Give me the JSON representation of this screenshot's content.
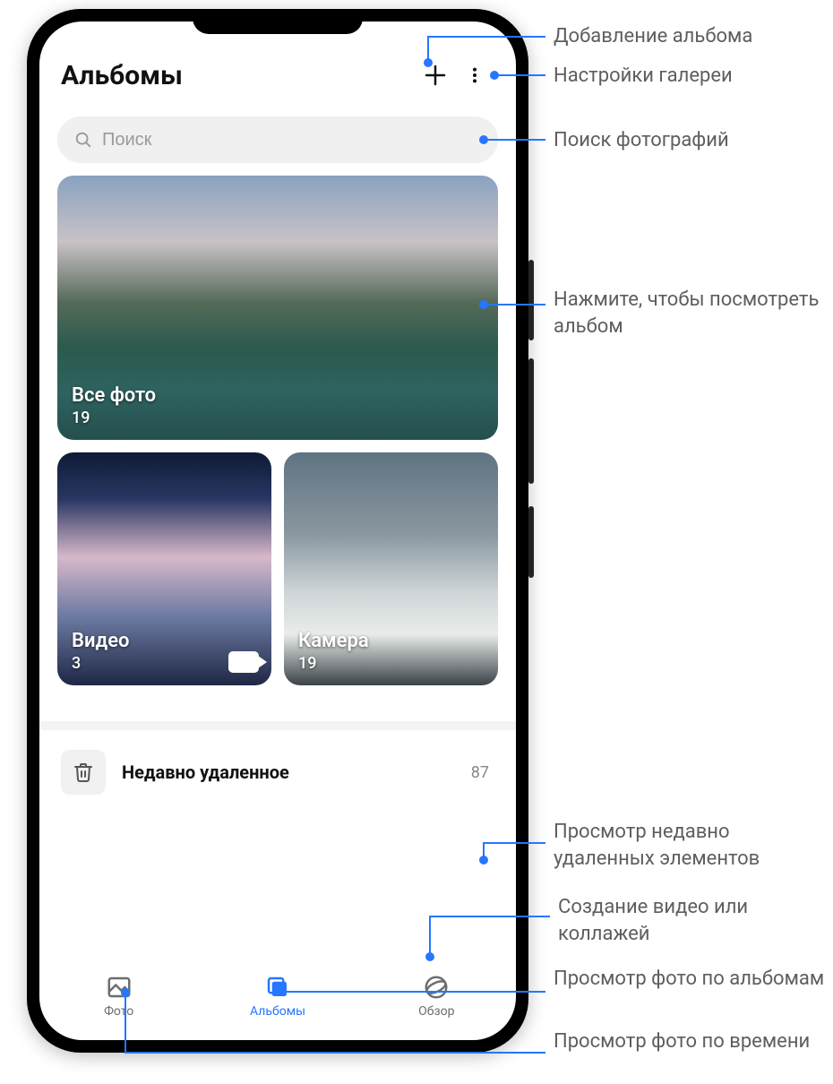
{
  "header": {
    "title": "Альбомы",
    "add_icon": "plus-icon",
    "menu_icon": "more-vertical-icon"
  },
  "search": {
    "placeholder": "Поиск",
    "icon": "search-icon"
  },
  "albums": [
    {
      "name": "Все фото",
      "count": "19",
      "kind": "big"
    },
    {
      "name": "Видео",
      "count": "3",
      "kind": "small",
      "video": true
    },
    {
      "name": "Камера",
      "count": "19",
      "kind": "small"
    }
  ],
  "recently_deleted": {
    "label": "Недавно удаленное",
    "count": "87",
    "icon": "trash-icon"
  },
  "navbar": [
    {
      "label": "Фото",
      "icon": "photo-nav-icon",
      "active": false
    },
    {
      "label": "Альбомы",
      "icon": "albums-nav-icon",
      "active": true
    },
    {
      "label": "Обзор",
      "icon": "discover-nav-icon",
      "active": false
    }
  ],
  "callouts": {
    "add_album": "Добавление альбома",
    "settings": "Настройки галереи",
    "search": "Поиск фотографий",
    "open_album": "Нажмите, чтобы посмотреть альбом",
    "recent_del": "Просмотр недавно удаленных элементов",
    "discover": "Создание видео или коллажей",
    "by_albums": "Просмотр фото по альбомам",
    "by_time": "Просмотр фото по времени"
  },
  "colors": {
    "accent": "#2676ff",
    "text_muted": "#5e5e5e"
  }
}
